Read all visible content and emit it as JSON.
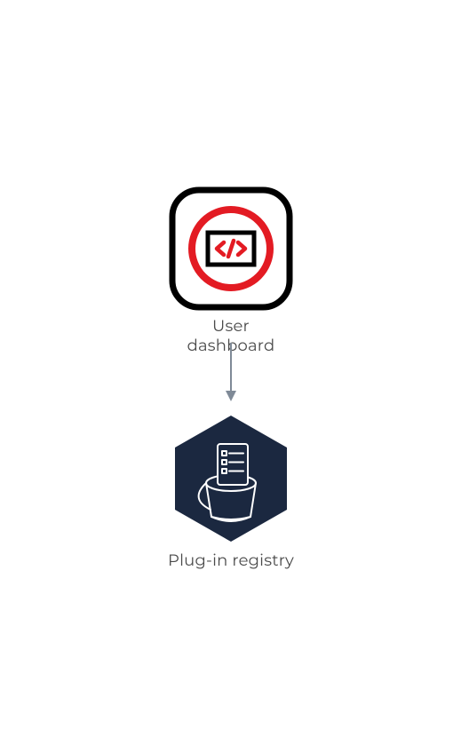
{
  "diagram": {
    "nodes": [
      {
        "id": "user-dashboard",
        "label": "User dashboard"
      },
      {
        "id": "plugin-registry",
        "label": "Plug-in registry"
      }
    ],
    "edges": [
      {
        "from": "user-dashboard",
        "to": "plugin-registry",
        "direction": "down"
      }
    ],
    "colors": {
      "accent_red": "#e31b23",
      "hex_dark": "#1b2840",
      "arrow": "#7f8a97",
      "text": "#4a4a4a"
    }
  }
}
